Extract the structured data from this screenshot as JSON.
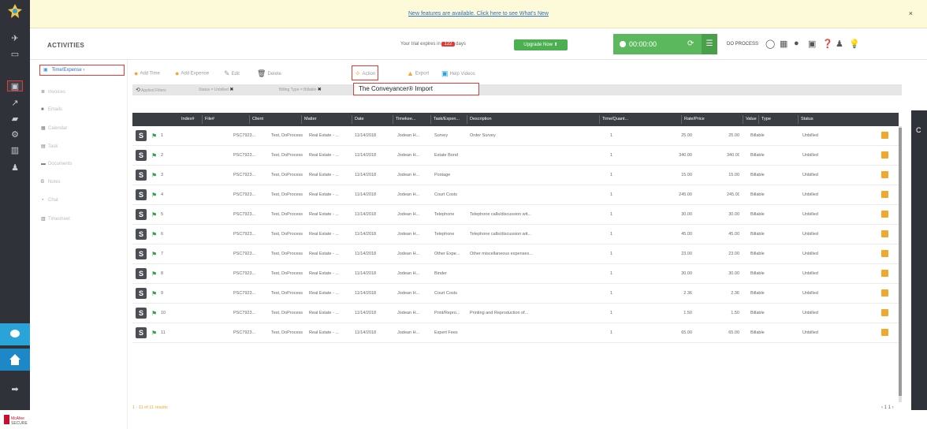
{
  "banner": {
    "message": "New features are available. Click here to see What's New",
    "close": "×"
  },
  "app": {
    "title": "ACTIVITIES"
  },
  "trial": {
    "prefix": "Your trial expires in",
    "days": "122",
    "suffix": "days",
    "upgrade": "Upgrade Now"
  },
  "timer": {
    "value": "00:00:00",
    "cycle": "⟳",
    "menu": "☰"
  },
  "header": {
    "brand": "DO PROCESS"
  },
  "rail": {
    "icons": [
      "briefcase-icon",
      "folder-icon",
      "activities-icon",
      "chart-icon",
      "tag-icon",
      "settings-icon",
      "report-icon",
      "person-icon"
    ]
  },
  "subnav": {
    "items": [
      {
        "label": "Time/Expense",
        "caret": "›",
        "icon": "▣"
      },
      {
        "label": "Invoices",
        "icon": "≣"
      },
      {
        "label": "Emails",
        "icon": "■"
      },
      {
        "label": "Calendar",
        "icon": "▦"
      },
      {
        "label": "Task",
        "icon": "▤"
      },
      {
        "label": "Documents",
        "icon": "▬"
      },
      {
        "label": "Notes",
        "icon": "B"
      },
      {
        "label": "Chat",
        "icon": "◔"
      },
      {
        "label": "Timesheet",
        "icon": "▥"
      }
    ]
  },
  "toolbar": {
    "add_time": "Add Time",
    "add_expense": "Add Expense",
    "edit": "Edit",
    "delete": "Delete",
    "action": "Action",
    "export": "Export",
    "help": "Help Videos"
  },
  "dropdown": {
    "item": "The Conveyancer® Import"
  },
  "filters": {
    "applied_label": "Applied Filters",
    "chips": [
      "Status = Unbilled",
      "Billing Type = Billable"
    ]
  },
  "table": {
    "columns": [
      "Index#",
      "File#",
      "Client",
      "Matter",
      "Date",
      "Timekee...",
      "Task/Expen...",
      "Description",
      "Time/Quant...",
      "Rate/Price",
      "Value",
      "Type",
      "Status"
    ],
    "rows": [
      {
        "index": "1",
        "file": "PSC7923...",
        "client": "Test, DoProcess",
        "matter": "Real Estate - ...",
        "date": "11/14/2018",
        "timekeeper": "Jodean H...",
        "task": "Survey",
        "description": "Order Survey",
        "qty": "1",
        "rate": "25.00",
        "value": "25.00",
        "type": "Billable",
        "status": "Unbilled"
      },
      {
        "index": "2",
        "file": "PSC7923...",
        "client": "Test, DoProcess",
        "matter": "Real Estate - ...",
        "date": "11/14/2018",
        "timekeeper": "Jodean H...",
        "task": "Estate Bond",
        "description": "",
        "qty": "1",
        "rate": "340.00",
        "value": "340.00",
        "type": "Billable",
        "status": "Unbilled"
      },
      {
        "index": "3",
        "file": "PSC7923...",
        "client": "Test, DoProcess",
        "matter": "Real Estate - ...",
        "date": "11/14/2018",
        "timekeeper": "Jodean H...",
        "task": "Postage",
        "description": "",
        "qty": "1",
        "rate": "15.00",
        "value": "15.00",
        "type": "Billable",
        "status": "Unbilled"
      },
      {
        "index": "4",
        "file": "PSC7923...",
        "client": "Test, DoProcess",
        "matter": "Real Estate - ...",
        "date": "11/14/2018",
        "timekeeper": "Jodean H...",
        "task": "Court Costs",
        "description": "",
        "qty": "1",
        "rate": "245.00",
        "value": "245.00",
        "type": "Billable",
        "status": "Unbilled"
      },
      {
        "index": "5",
        "file": "PSC7923...",
        "client": "Test, DoProcess",
        "matter": "Real Estate - ...",
        "date": "11/14/2018",
        "timekeeper": "Jodean H...",
        "task": "Telephone",
        "description": "Telephone calls/discussion wit...",
        "qty": "1",
        "rate": "30.00",
        "value": "30.00",
        "type": "Billable",
        "status": "Unbilled"
      },
      {
        "index": "6",
        "file": "PSC7923...",
        "client": "Test, DoProcess",
        "matter": "Real Estate - ...",
        "date": "11/14/2018",
        "timekeeper": "Jodean H...",
        "task": "Telephone",
        "description": "Telephone calls/discussion wit...",
        "qty": "1",
        "rate": "45.00",
        "value": "45.00",
        "type": "Billable",
        "status": "Unbilled"
      },
      {
        "index": "7",
        "file": "PSC7923...",
        "client": "Test, DoProcess",
        "matter": "Real Estate - ...",
        "date": "11/14/2018",
        "timekeeper": "Jodean H...",
        "task": "Other Expe...",
        "description": "Other miscellaneous expenses...",
        "qty": "1",
        "rate": "23.00",
        "value": "23.00",
        "type": "Billable",
        "status": "Unbilled"
      },
      {
        "index": "8",
        "file": "PSC7923...",
        "client": "Test, DoProcess",
        "matter": "Real Estate - ...",
        "date": "11/14/2018",
        "timekeeper": "Jodean H...",
        "task": "Binder",
        "description": "",
        "qty": "1",
        "rate": "30.00",
        "value": "30.00",
        "type": "Billable",
        "status": "Unbilled"
      },
      {
        "index": "9",
        "file": "PSC7923...",
        "client": "Test, DoProcess",
        "matter": "Real Estate - ...",
        "date": "11/14/2018",
        "timekeeper": "Jodean H...",
        "task": "Court Costs",
        "description": "",
        "qty": "1",
        "rate": "2.36",
        "value": "2.36",
        "type": "Billable",
        "status": "Unbilled"
      },
      {
        "index": "10",
        "file": "PSC7923...",
        "client": "Test, DoProcess",
        "matter": "Real Estate - ...",
        "date": "11/14/2018",
        "timekeeper": "Jodean H...",
        "task": "Print/Repro...",
        "description": "Printing and Reproduction of...",
        "qty": "1",
        "rate": "1.50",
        "value": "1.50",
        "type": "Billable",
        "status": "Unbilled"
      },
      {
        "index": "11",
        "file": "PSC7923...",
        "client": "Test, DoProcess",
        "matter": "Real Estate - ...",
        "date": "11/14/2018",
        "timekeeper": "Jodean H...",
        "task": "Expert Fees",
        "description": "",
        "qty": "1",
        "rate": "65.00",
        "value": "65.00",
        "type": "Billable",
        "status": "Unbilled"
      }
    ]
  },
  "footer": {
    "results": "1 - 11 of 11 results",
    "pager": "‹ 1 1 ›"
  },
  "colors": {
    "rail": "#2f3238",
    "accent_green": "#5cb85c",
    "highlight_red": "#e53935",
    "link_blue": "#2a6ec6"
  }
}
